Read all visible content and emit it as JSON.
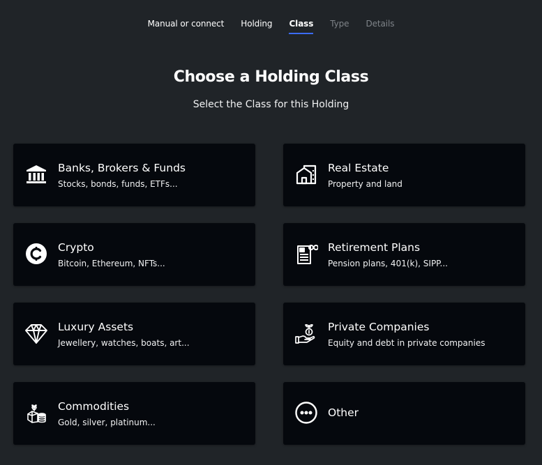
{
  "stepper": {
    "steps": [
      {
        "label": "Manual or connect",
        "state": "done"
      },
      {
        "label": "Holding",
        "state": "done"
      },
      {
        "label": "Class",
        "state": "active"
      },
      {
        "label": "Type",
        "state": "disabled"
      },
      {
        "label": "Details",
        "state": "disabled"
      }
    ],
    "active_color": "#3b6cf6"
  },
  "heading": {
    "title": "Choose a Holding Class",
    "subtitle": "Select the Class for this Holding"
  },
  "classes": [
    {
      "title": "Banks, Brokers & Funds",
      "subtitle": "Stocks, bonds, funds, ETFs...",
      "icon": "bank-icon"
    },
    {
      "title": "Real Estate",
      "subtitle": "Property and land",
      "icon": "house-icon"
    },
    {
      "title": "Crypto",
      "subtitle": "Bitcoin, Ethereum, NFTs...",
      "icon": "crypto-coin-icon"
    },
    {
      "title": "Retirement Plans",
      "subtitle": "Pension plans, 401(k), SIPP...",
      "icon": "retirement-document-icon"
    },
    {
      "title": "Luxury Assets",
      "subtitle": "Jewellery, watches, boats, art...",
      "icon": "diamond-icon"
    },
    {
      "title": "Private Companies",
      "subtitle": "Equity and debt in private companies",
      "icon": "investment-hand-icon"
    },
    {
      "title": "Commodities",
      "subtitle": "Gold, silver, platinum...",
      "icon": "commodities-icon"
    },
    {
      "title": "Other",
      "subtitle": "",
      "icon": "more-dots-icon"
    }
  ],
  "colors": {
    "background": "#202428",
    "card": "#05080d",
    "disabled_text": "#7f8489"
  }
}
